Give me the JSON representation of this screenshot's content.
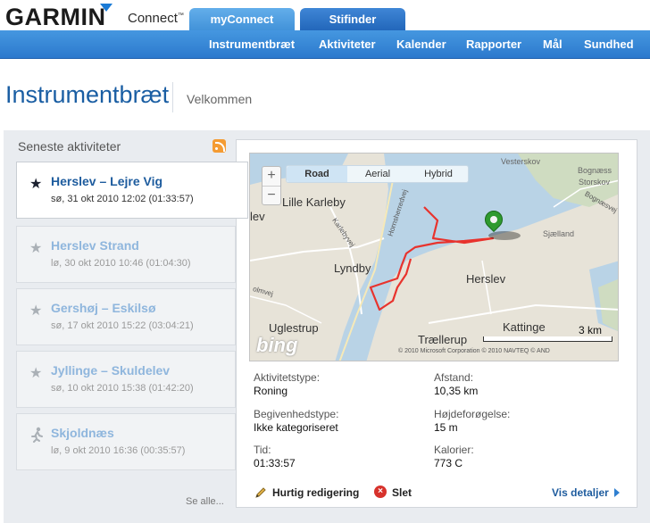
{
  "brand": {
    "name": "GARMIN",
    "product": "Connect",
    "tm": "™"
  },
  "tabs": [
    {
      "label": "myConnect",
      "active": true
    },
    {
      "label": "Stifinder",
      "active": false
    }
  ],
  "nav": [
    "Instrumentbræt",
    "Aktiviteter",
    "Kalender",
    "Rapporter",
    "Mål",
    "Sundhed"
  ],
  "page": {
    "title": "Instrumentbræt",
    "welcome": "Velkommen"
  },
  "activities": {
    "heading": "Seneste aktiviteter",
    "see_all": "Se alle...",
    "items": [
      {
        "title": "Herslev – Lejre Vig",
        "subtitle": "sø, 31 okt 2010 12:02 (01:33:57)",
        "icon": "star-icon",
        "selected": true
      },
      {
        "title": "Herslev Strand",
        "subtitle": "lø, 30 okt 2010 10:46 (01:04:30)",
        "icon": "star-icon",
        "selected": false
      },
      {
        "title": "Gershøj – Eskilsø",
        "subtitle": "sø, 17 okt 2010 15:22 (03:04:21)",
        "icon": "star-icon",
        "selected": false
      },
      {
        "title": "Jyllinge – Skuldelev",
        "subtitle": "sø, 10 okt 2010 15:38 (01:42:20)",
        "icon": "star-icon",
        "selected": false
      },
      {
        "title": "Skjoldnæs",
        "subtitle": "lø, 9 okt 2010 16:36 (00:35:57)",
        "icon": "runner-icon",
        "selected": false
      }
    ]
  },
  "map": {
    "types": [
      "Road",
      "Aerial",
      "Hybrid"
    ],
    "selected_type": "Road",
    "labels": {
      "lille_karleby": "Lille Karleby",
      "lyndby": "Lyndby",
      "herslev": "Herslev",
      "uglestrup": "Uglestrup",
      "traellerup": "Trællerup",
      "kattinge": "Kattinge",
      "sjaelland": "Sjælland",
      "vesterskov": "Vesterskov",
      "bognaes": "Bognæss",
      "storskov": "Storskov",
      "lev": "lev"
    },
    "road_labels": {
      "hornsherred": "Hornsherredvej",
      "karlebyvej": "Karlebyvej",
      "bognaesvej": "Bognæsvej",
      "olmvej": "olmvej"
    },
    "scale": "3 km",
    "copyright": "© 2010 Microsoft Corporation   © 2010 NAVTEQ © AND",
    "logo": "bing"
  },
  "details": {
    "activity_type_label": "Aktivitetstype:",
    "activity_type": "Roning",
    "event_type_label": "Begivenhedstype:",
    "event_type": "Ikke kategoriseret",
    "time_label": "Tid:",
    "time": "01:33:57",
    "distance_label": "Afstand:",
    "distance": "10,35 km",
    "elevation_label": "Højdeforøgelse:",
    "elevation": "15 m",
    "calories_label": "Kalorier:",
    "calories": "773 C"
  },
  "actions": {
    "quick_edit": "Hurtig redigering",
    "delete": "Slet",
    "view_details": "Vis detaljer"
  },
  "colors": {
    "nav_blue": "#2c79cd",
    "title_blue": "#1a5ea3",
    "route_red": "#e8332d",
    "pin_green": "#2f9a2f",
    "rss_orange": "#f49b32"
  }
}
